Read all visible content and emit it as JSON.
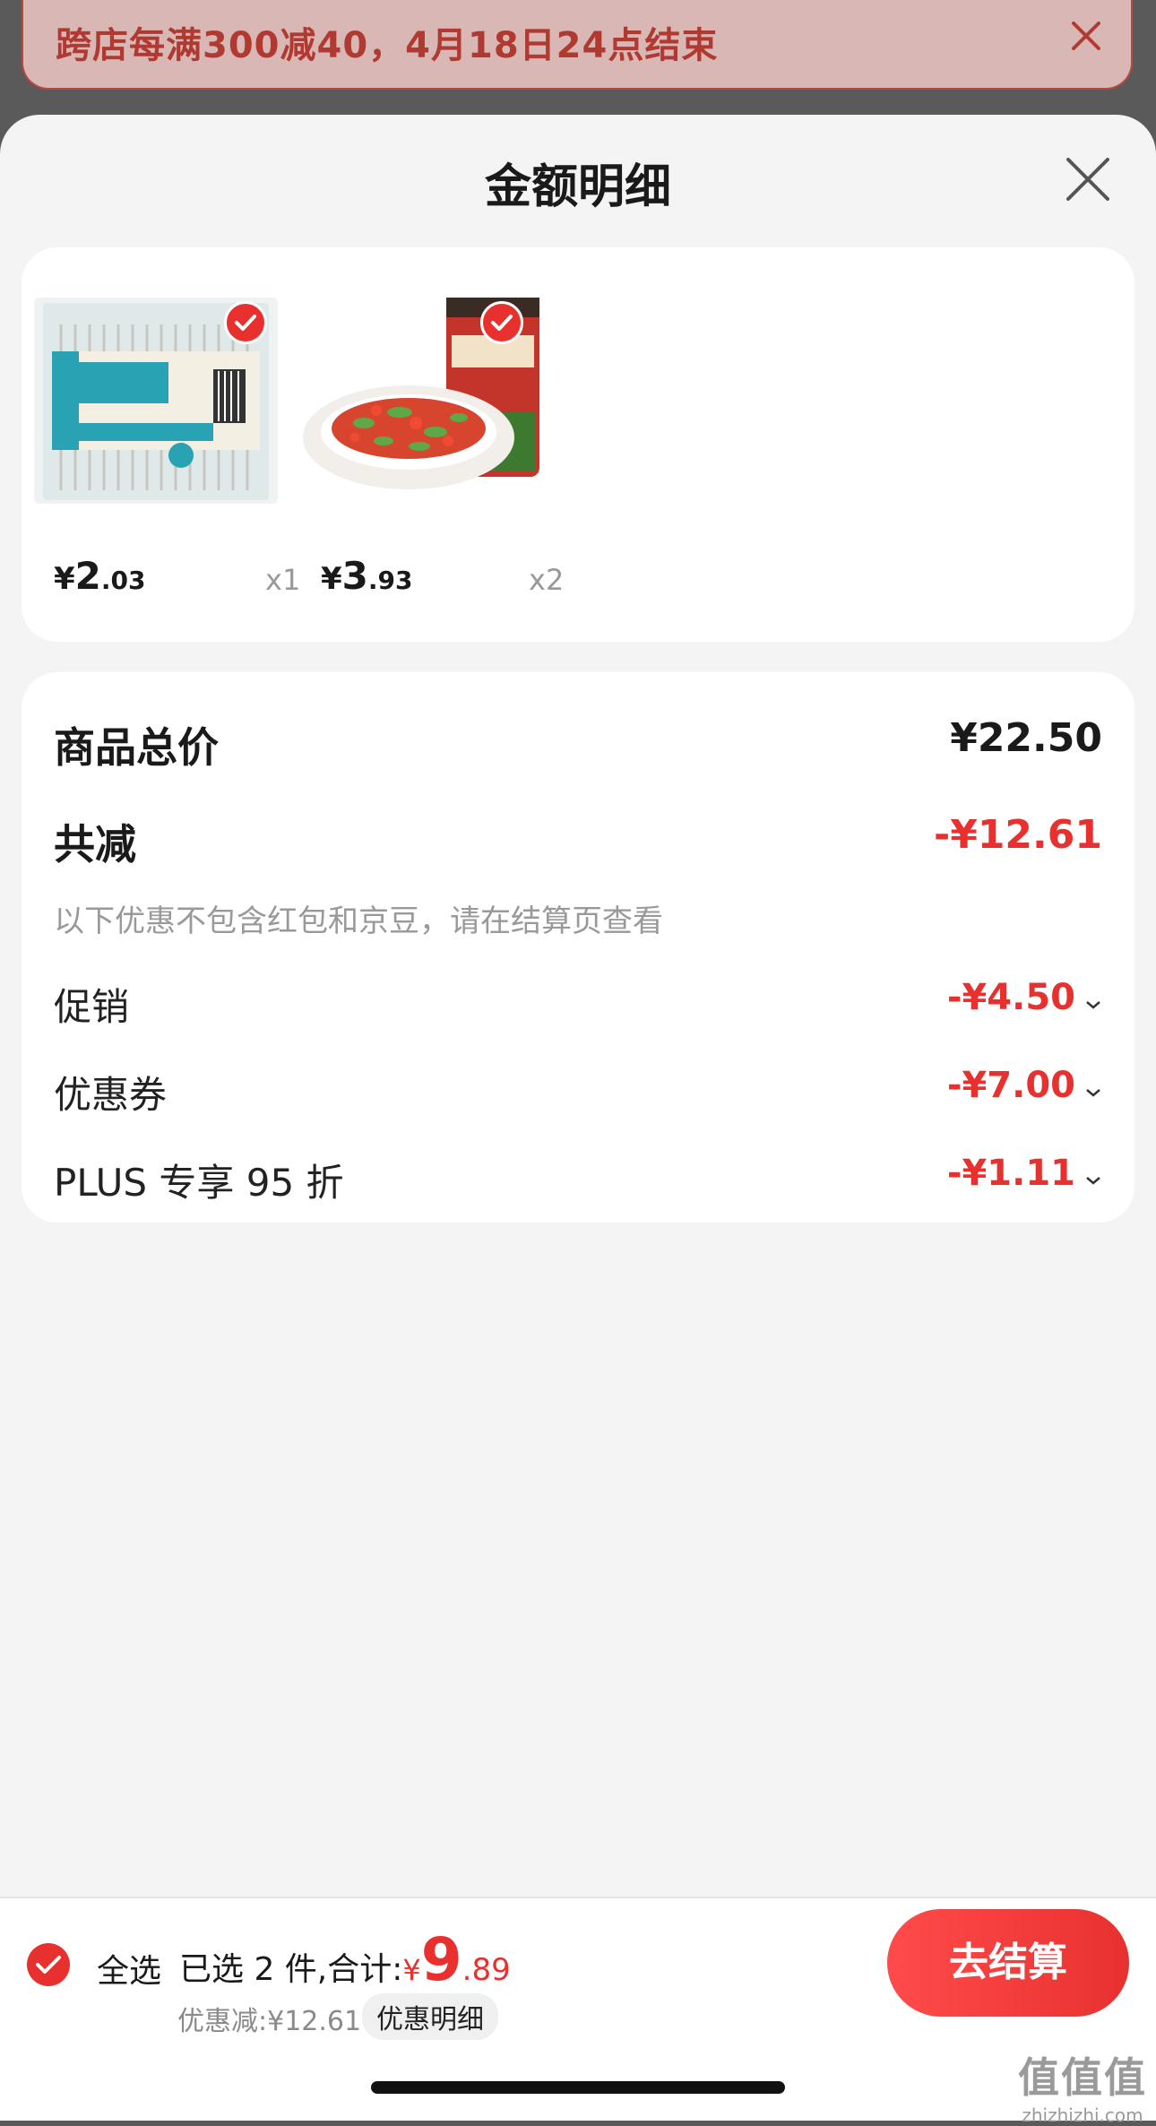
{
  "banner": {
    "text": "跨店每满300减40，4月18日24点结束"
  },
  "sheet": {
    "title": "金额明细"
  },
  "products": [
    {
      "price_currency": "¥",
      "price_int": "2",
      "price_dec": ".03",
      "qty": "x1"
    },
    {
      "price_currency": "¥",
      "price_int": "3",
      "price_dec": ".93",
      "qty": "x2"
    }
  ],
  "summary": {
    "total_label": "商品总价",
    "total_value": "¥22.50",
    "reduce_label": "共减",
    "reduce_value": "-¥12.61",
    "note": "以下优惠不包含红包和京豆，请在结算页查看",
    "items": [
      {
        "label": "促销",
        "value": "-¥4.50"
      },
      {
        "label": "优惠券",
        "value": "-¥7.00"
      },
      {
        "label": "PLUS 专享 95 折",
        "value": "-¥1.11"
      }
    ]
  },
  "bottom_bar": {
    "select_all": "全选",
    "selected_text": "已选 2 件,合计:",
    "total_currency": "¥",
    "total_int": "9",
    "total_dec": ".89",
    "discount_text": "优惠减:¥12.61",
    "detail_chip": "优惠明细",
    "checkout": "去结算"
  },
  "watermark": {
    "big": "值值值",
    "small": "zhizhizhi.com"
  },
  "colors": {
    "accent_red": "#e8312f",
    "banner_text": "#b03a32",
    "banner_bg": "#d9b7b5"
  }
}
